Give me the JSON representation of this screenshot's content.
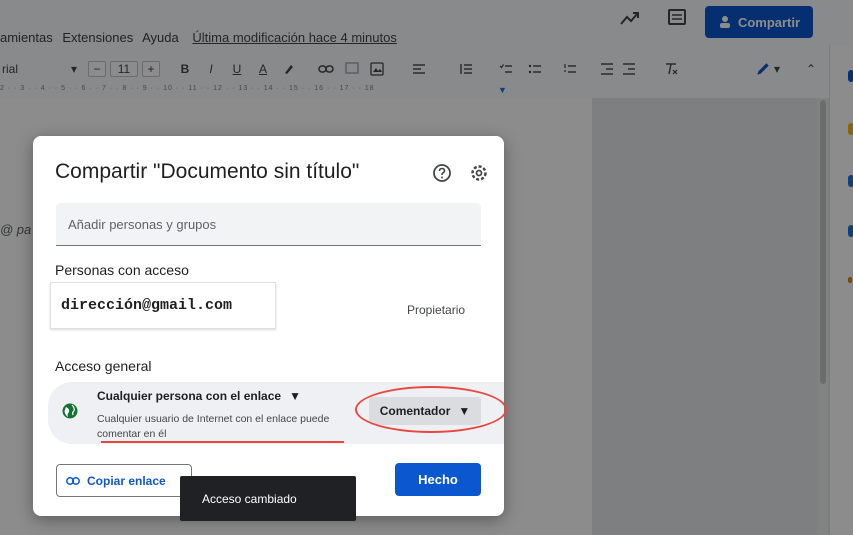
{
  "app": {
    "menus": [
      "amientas",
      "Extensiones",
      "Ayuda"
    ],
    "last_modified": "Última modificación hace 4 minutos",
    "share_label": "Compartir"
  },
  "toolbar": {
    "font_name": "rial",
    "font_size": "11",
    "minus": "−",
    "plus": "+",
    "bold": "B",
    "italic": "I",
    "underline": "U",
    "text_color": "A"
  },
  "ruler": {
    "marks": "2 · · 3 · · 4 · · 5 · · 6 · · 7 · · 8 · · 9 · · 10 · · 11 · · 12 · · 13 · · 14 · · 15 · · 16 · · 17 · · 18"
  },
  "document": {
    "snippet": "@ pa"
  },
  "dialog": {
    "title": "Compartir \"Documento sin título\"",
    "add_placeholder": "Añadir personas y grupos",
    "people_heading": "Personas con acceso",
    "email": "dirección@gmail.com",
    "owner_role": "Propietario",
    "general_heading": "Acceso general",
    "link_scope": "Cualquier persona con el enlace",
    "scope_desc": "Cualquier usuario de Internet con el enlace puede comentar en él",
    "role": "Comentador",
    "copy_link": "Copiar enlace",
    "done": "Hecho"
  },
  "toast": {
    "message": "Acceso cambiado"
  },
  "colors": {
    "primary": "#0b57d0",
    "annotation_red": "#e8473f",
    "overlay": "rgba(0,0,0,0.45)"
  }
}
